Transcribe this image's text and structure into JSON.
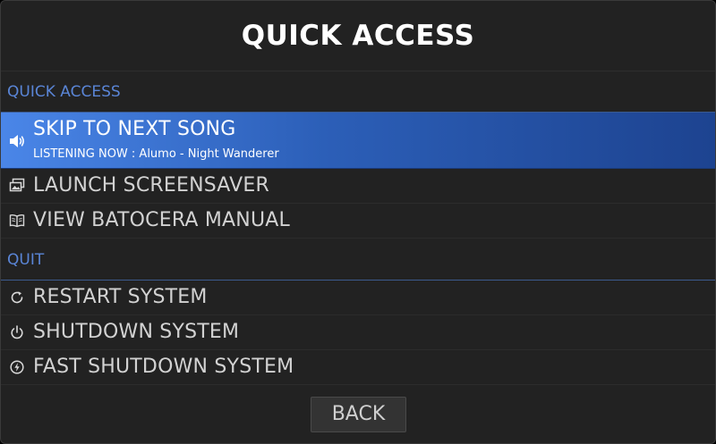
{
  "title": "QUICK ACCESS",
  "sections": [
    {
      "header": "QUICK ACCESS",
      "items": [
        {
          "label": "SKIP TO NEXT SONG",
          "sublabel": "LISTENING NOW : Alumo - Night Wanderer",
          "icon": "speaker-icon",
          "selected": true
        },
        {
          "label": "LAUNCH SCREENSAVER",
          "icon": "screensaver-icon"
        },
        {
          "label": "VIEW BATOCERA MANUAL",
          "icon": "book-icon"
        }
      ]
    },
    {
      "header": "QUIT",
      "items": [
        {
          "label": "RESTART SYSTEM",
          "icon": "restart-icon"
        },
        {
          "label": "SHUTDOWN SYSTEM",
          "icon": "power-icon"
        },
        {
          "label": "FAST SHUTDOWN SYSTEM",
          "icon": "fast-power-icon"
        }
      ]
    }
  ],
  "back_label": "BACK",
  "colors": {
    "background": "#222222",
    "accent": "#5a85d6",
    "selection_start": "#4a86e8",
    "selection_end": "#1d4390",
    "title": "#ffffff",
    "text": "#d2d2d2"
  }
}
